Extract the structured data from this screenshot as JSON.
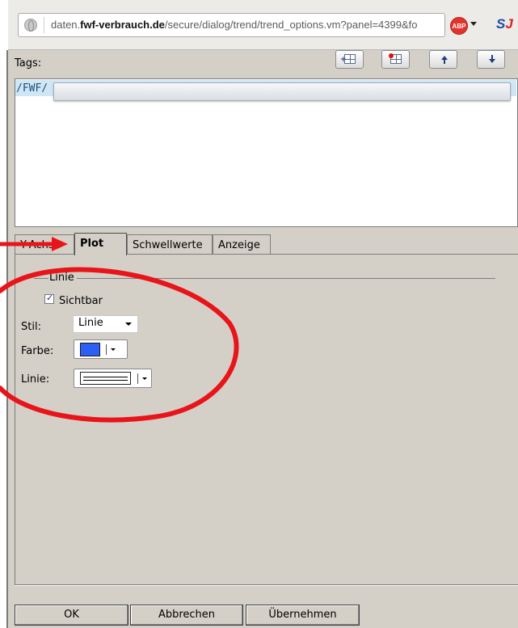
{
  "browser": {
    "url_prefix": "daten.",
    "url_domain": "fwf-verbrauch.de",
    "url_path": "/secure/dialog/trend/trend_options.vm?panel=4399&fo",
    "abp_badge": "ABP",
    "extension_label": "S",
    "extension_accent": "J"
  },
  "tags": {
    "label": "Tags:",
    "items": [
      "/FWF/"
    ],
    "toolbar": [
      "add-tag",
      "remove-tag",
      "move-up",
      "move-down"
    ]
  },
  "tabs": [
    {
      "label": "Y-Achse",
      "active": false
    },
    {
      "label": "Plot",
      "active": true
    },
    {
      "label": "Schwellwerte",
      "active": false
    },
    {
      "label": "Anzeige",
      "active": false
    }
  ],
  "plot": {
    "fieldset_legend": "Linie",
    "visible_label": "Sichtbar",
    "visible_checked": true,
    "style_label": "Stil:",
    "style_value": "Linie",
    "color_label": "Farbe:",
    "color_value": "#2c5ff5",
    "line_label": "Linie:"
  },
  "buttons": {
    "ok": "OK",
    "cancel": "Abbrechen",
    "apply": "Übernehmen"
  },
  "annotation": {
    "color": "#e8141a"
  }
}
